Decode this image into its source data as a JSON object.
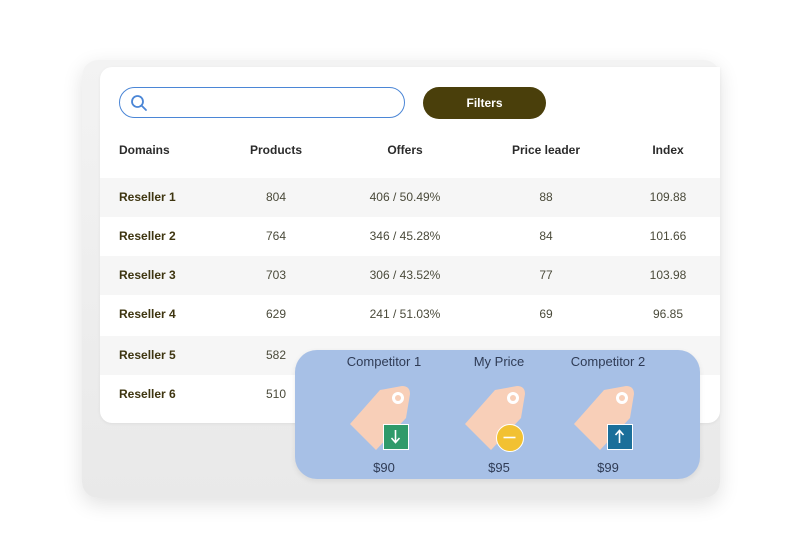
{
  "search": {
    "placeholder": "",
    "value": ""
  },
  "toolbar": {
    "filters_label": "Filters"
  },
  "table": {
    "headers": {
      "domains": "Domains",
      "products": "Products",
      "offers": "Offers",
      "price_leader": "Price leader",
      "index": "Index"
    },
    "rows": [
      {
        "domain": "Reseller 1",
        "products": "804",
        "offers": "406 / 50.49%",
        "price_leader": "88",
        "index": "109.88"
      },
      {
        "domain": "Reseller 2",
        "products": "764",
        "offers": "346 / 45.28%",
        "price_leader": "84",
        "index": "101.66"
      },
      {
        "domain": "Reseller 3",
        "products": "703",
        "offers": "306 / 43.52%",
        "price_leader": "77",
        "index": "103.98"
      },
      {
        "domain": "Reseller 4",
        "products": "629",
        "offers": "241 / 51.03%",
        "price_leader": "69",
        "index": "96.85"
      },
      {
        "domain": "Reseller 5",
        "products": "582"
      },
      {
        "domain": "Reseller 6",
        "products": "510"
      }
    ]
  },
  "comparison": {
    "items": [
      {
        "label": "Competitor 1",
        "price": "$90",
        "indicator": "arrow-down-icon"
      },
      {
        "label": "My Price",
        "price": "$95",
        "indicator": "equal-icon"
      },
      {
        "label": "Competitor 2",
        "price": "$99",
        "indicator": "arrow-up-icon"
      }
    ]
  },
  "colors": {
    "accent": "#4a3f0b",
    "search_border": "#4b86d6",
    "popup_bg": "#a7c0e6",
    "tag": "#f8cfb8",
    "down": "#2f9a6a",
    "equal": "#f2c132",
    "up": "#1b6f9a"
  }
}
